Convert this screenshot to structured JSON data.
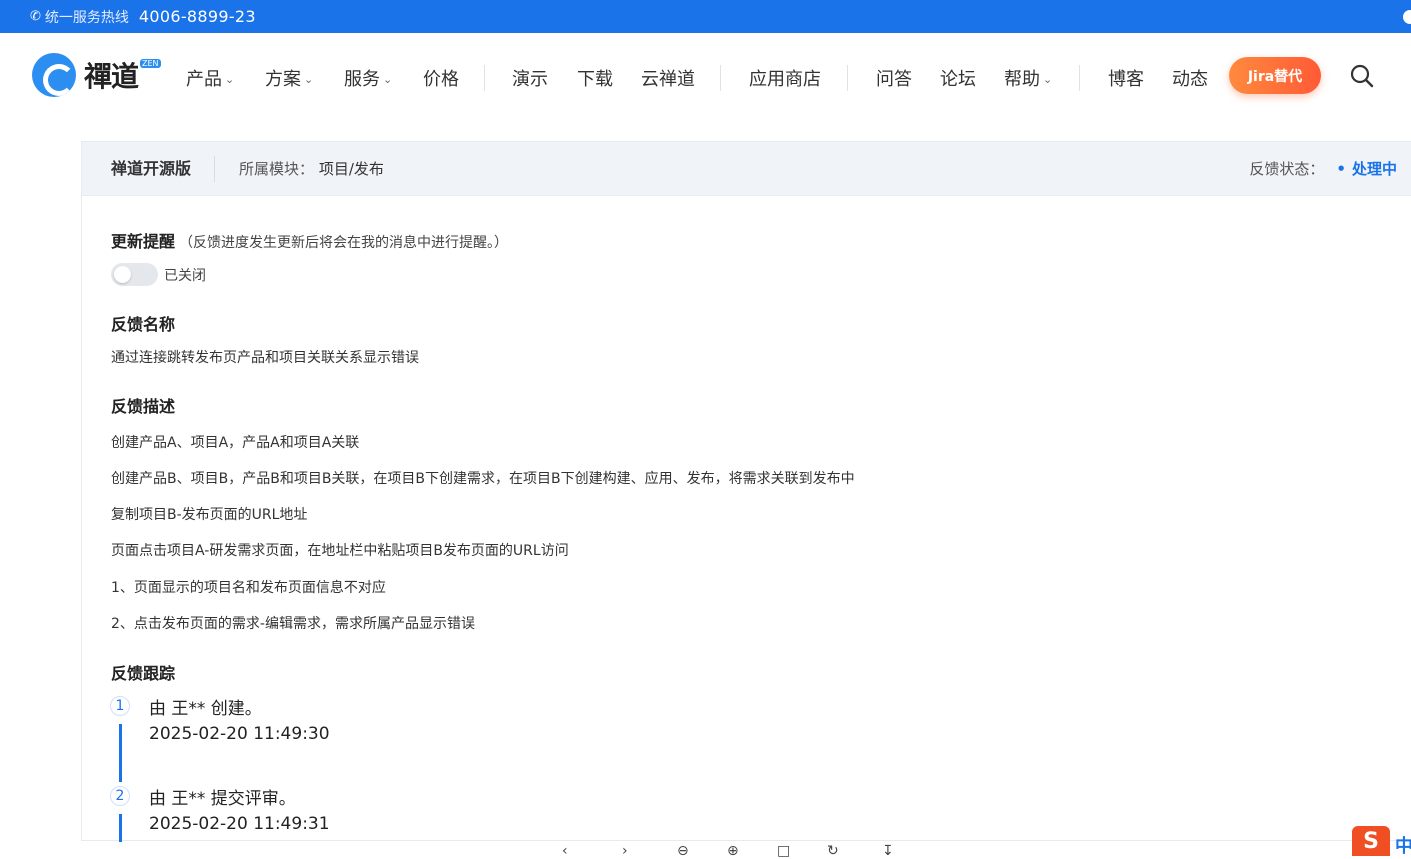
{
  "topbar": {
    "hotline_label": "统一服务热线",
    "hotline_number": "4006-8899-23"
  },
  "brand": {
    "logo_text": "禪道",
    "logo_badge": "ZEN"
  },
  "nav": {
    "items": [
      {
        "label": "产品",
        "dropdown": true
      },
      {
        "label": "方案",
        "dropdown": true
      },
      {
        "label": "服务",
        "dropdown": true
      },
      {
        "label": "价格",
        "dropdown": false
      },
      {
        "label": "演示",
        "dropdown": false
      },
      {
        "label": "下载",
        "dropdown": false
      },
      {
        "label": "云禅道",
        "dropdown": false
      },
      {
        "label": "应用商店",
        "dropdown": false
      },
      {
        "label": "问答",
        "dropdown": false
      },
      {
        "label": "论坛",
        "dropdown": false
      },
      {
        "label": "帮助",
        "dropdown": true
      },
      {
        "label": "博客",
        "dropdown": false
      },
      {
        "label": "动态",
        "dropdown": false
      }
    ],
    "cta_label": "Jira替代",
    "search_icon": "search-icon"
  },
  "feedback": {
    "edition": "禅道开源版",
    "module_key": "所属模块：",
    "module_value": "项目/发布",
    "status_key": "反馈状态：",
    "status_value": "处理中",
    "update_reminder": {
      "title": "更新提醒",
      "note": "（反馈进度发生更新后将会在我的消息中进行提醒。）",
      "toggle_label": "已关闭",
      "enabled": false
    },
    "name_title": "反馈名称",
    "name_value": "通过连接跳转发布页产品和项目关联关系显示错误",
    "desc_title": "反馈描述",
    "desc_lines": [
      "创建产品A、项目A，产品A和项目A关联",
      "创建产品B、项目B，产品B和项目B关联，在项目B下创建需求，在项目B下创建构建、应用、发布，将需求关联到发布中",
      "复制项目B-发布页面的URL地址",
      "页面点击项目A-研发需求页面，在地址栏中粘贴项目B发布页面的URL访问",
      "1、页面显示的项目名和发布页面信息不对应",
      "2、点击发布页面的需求-编辑需求，需求所属产品显示错误"
    ],
    "track_title": "反馈跟踪",
    "track": [
      {
        "num": "1",
        "text": "由 王** 创建。",
        "time": "2025-02-20 11:49:30"
      },
      {
        "num": "2",
        "text": "由 王** 提交评审。",
        "time": "2025-02-20 11:49:31"
      }
    ]
  },
  "ime": {
    "logo": "S",
    "mode": "中"
  }
}
